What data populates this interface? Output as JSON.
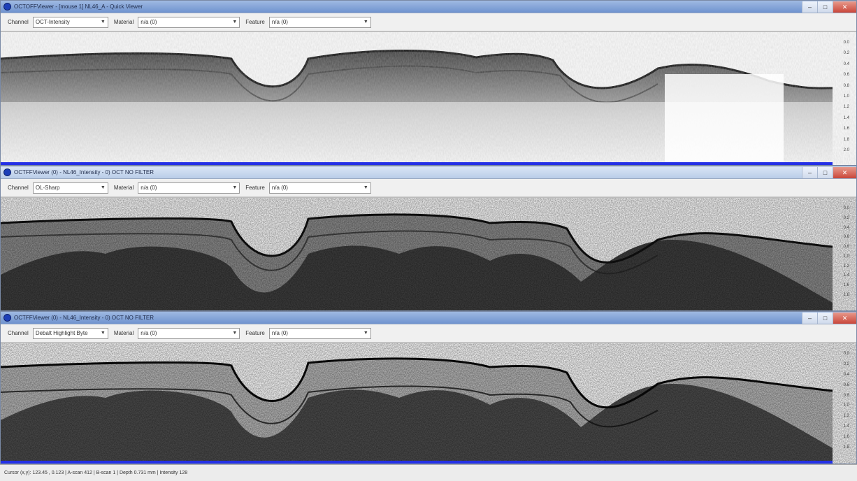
{
  "windows": [
    {
      "title": "OCTOFFViewer - [mouse 1] NL46_A - Quick Viewer",
      "channel_label": "Channel",
      "channel_value": "OCT-Intensity",
      "material_label": "Material",
      "material_value": "n/a (0)",
      "feature_label": "Feature",
      "feature_value": "n/a (0)",
      "scale": [
        "0.0",
        "0.2",
        "0.4",
        "0.6",
        "0.8",
        "1.0",
        "1.2",
        "1.4",
        "1.6",
        "1.8",
        "2.0"
      ]
    },
    {
      "title": "OCTFFViewer (0) - NL46_Intensity - 0) OCT NO FILTER",
      "channel_label": "Channel",
      "channel_value": "OL-Sharp",
      "material_label": "Material",
      "material_value": "n/a (0)",
      "feature_label": "Feature",
      "feature_value": "n/a (0)",
      "scale": [
        "0.0",
        "0.2",
        "0.4",
        "0.6",
        "0.8",
        "1.0",
        "1.2",
        "1.4",
        "1.6",
        "1.8"
      ]
    },
    {
      "title": "OCTFFViewer (0) - NL46_Intensity - 0) OCT NO FILTER",
      "channel_label": "Channel",
      "channel_value": "Debalt Highlight Byte",
      "material_label": "Material",
      "material_value": "n/a (0)",
      "feature_label": "Feature",
      "feature_value": "n/a (0)",
      "scale": [
        "0.0",
        "0.2",
        "0.4",
        "0.6",
        "0.8",
        "1.0",
        "1.2",
        "1.4",
        "1.6",
        "1.8"
      ]
    }
  ],
  "titlebar_buttons": {
    "minimize": "–",
    "maximize": "□",
    "close": "✕"
  },
  "status": {
    "text": "Cursor (x,y): 123.45 , 0.123  |  A-scan 412  |  B-scan 1  |  Depth 0.731 mm  |  Intensity 128"
  },
  "icons": {
    "app": "app-icon",
    "dropdown": "chevron-down-icon"
  },
  "colors": {
    "accent_bar": "#2430e6",
    "active_title": "#6f93cf",
    "close": "#c9463a"
  }
}
